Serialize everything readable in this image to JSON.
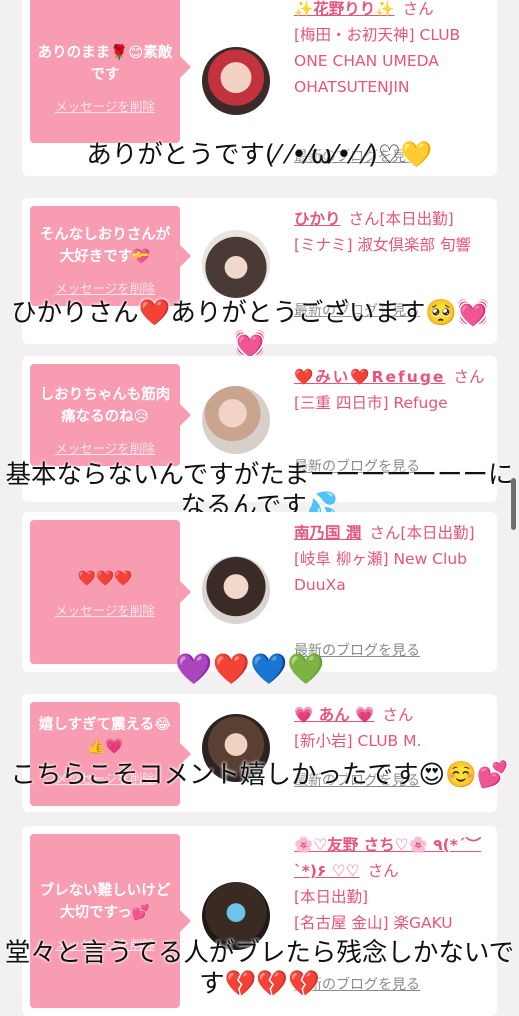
{
  "comments": [
    {
      "message": "ありのまま🌹😊素敵です",
      "delete_label": "メッセージを削除",
      "name": "✨花野りり✨",
      "san": "さん",
      "shop": "[梅田・お初天神] CLUB ONE CHAN UMEDA OHATSUTENJIN",
      "blog_label": "最新のブログを見る",
      "reply": "ありがとうです(⁄ ⁄•⁄ω⁄•⁄ ⁄)♡💛"
    },
    {
      "message": "そんなしおりさんが大好きです💝",
      "delete_label": "メッセージを削除",
      "name": "ひかり",
      "san": "さん[本日出勤]",
      "shop": "[ミナミ] 淑女倶楽部 旬響",
      "blog_label": "最新のブログを見る",
      "reply": "ひかりさん❤️ありがとうございます🥺💓💓"
    },
    {
      "message": "しおりちゃんも筋肉痛なるのね😥",
      "delete_label": "メッセージを削除",
      "name": "❤️みい❤️Refuge",
      "san": "さん",
      "shop": "[三重 四日市] Refuge",
      "blog_label": "最新のブログを見る",
      "reply": "基本ならないんですがたまーーーーーーーになるんです💦"
    },
    {
      "message": "❤️❤️❤️",
      "delete_label": "メッセージを削除",
      "name": "南乃国 潤",
      "san": "さん[本日出勤]",
      "shop": "[岐阜 柳ヶ瀬] New Club DuuXa",
      "blog_label": "最新のブログを見る",
      "reply": "💜❤️💙💚"
    },
    {
      "message": "嬉しすぎて震える😂👍💗",
      "delete_label": "メッセージを削除",
      "name": "💗 あん 💗",
      "san": "さん",
      "shop": "[新小岩] CLUB M.",
      "blog_label": "最新のブログを見る",
      "reply": "こちらこそコメント嬉しかったです😍☺️💕"
    },
    {
      "message": "ブレない難しいけど大切ですっ💕",
      "delete_label": "メッセージを削除",
      "name": "🌸♡友野 さち♡🌸 ٩(*´︶`*)۶ ♡♡",
      "san": "さん",
      "status": "[本日出勤]",
      "shop": "[名古屋 金山] 楽GAKU",
      "blog_label": "最新のブログを見る",
      "reply": "堂々と言うてる人がブレたら残念しかないです💔💔💔"
    }
  ],
  "colors": {
    "bubble": "#f89cb1",
    "accent": "#e8547a",
    "background": "#f2f0f1"
  }
}
